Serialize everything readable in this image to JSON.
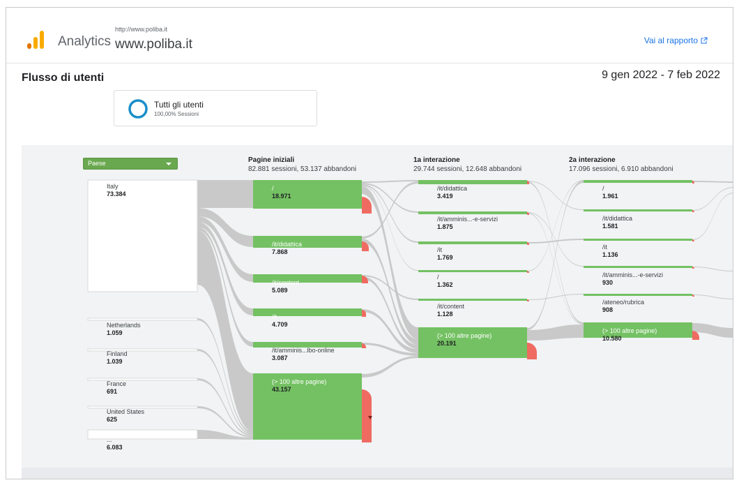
{
  "header": {
    "app_name": "Analytics",
    "property_url": "http://www.poliba.it",
    "property_name": "www.poliba.it",
    "report_link": "Vai al rapporto"
  },
  "page": {
    "title": "Flusso di utenti",
    "date_range": "9 gen 2022 - 7 feb 2022"
  },
  "segment": {
    "name": "Tutti gli utenti",
    "subtitle": "100,00% Sessioni"
  },
  "dimension": {
    "selected": "Paese"
  },
  "columns": [
    {
      "title": "Pagine iniziali",
      "subtitle": "82.881 sessioni, 53.137 abbandoni"
    },
    {
      "title": "1a interazione",
      "subtitle": "29.744 sessioni, 12.648 abbandoni"
    },
    {
      "title": "2a interazione",
      "subtitle": "17.096 sessioni, 6.910 abbandoni"
    }
  ],
  "countries": [
    {
      "label": "Italy",
      "value": "73.384"
    },
    {
      "label": "Netherlands",
      "value": "1.059"
    },
    {
      "label": "Finland",
      "value": "1.039"
    },
    {
      "label": "France",
      "value": "691"
    },
    {
      "label": "United States",
      "value": "625"
    },
    {
      "label": "...",
      "value": "6.083"
    }
  ],
  "start_pages": [
    {
      "label": "/",
      "value": "18.971"
    },
    {
      "label": "/it/didattica",
      "value": "7.868"
    },
    {
      "label": "/it/content",
      "value": "5.089"
    },
    {
      "label": "/it",
      "value": "4.709"
    },
    {
      "label": "/it/amminis...lbo-online",
      "value": "3.087"
    },
    {
      "label": "(> 100 altre pagine)",
      "value": "43.157"
    }
  ],
  "interaction_1": [
    {
      "label": "/it/didattica",
      "value": "3.419"
    },
    {
      "label": "/it/amminis...-e-servizi",
      "value": "1.875"
    },
    {
      "label": "/it",
      "value": "1.769"
    },
    {
      "label": "/",
      "value": "1.362"
    },
    {
      "label": "/it/content",
      "value": "1.128"
    },
    {
      "label": "(> 100 altre pagine)",
      "value": "20.191"
    }
  ],
  "interaction_2": [
    {
      "label": "/",
      "value": "1.961"
    },
    {
      "label": "/it/didattica",
      "value": "1.581"
    },
    {
      "label": "/it",
      "value": "1.136"
    },
    {
      "label": "/it/amminis...-e-servizi",
      "value": "930"
    },
    {
      "label": "/ateneo/rubrica",
      "value": "908"
    },
    {
      "label": "(> 100 altre pagine)",
      "value": "10.580"
    }
  ],
  "colors": {
    "node_green": "#74c163",
    "dropoff_red": "#ef6b61",
    "flow_gray": "#c4c4c4",
    "link_blue": "#1a73e8",
    "segment_ring": "#1a8ec9"
  }
}
